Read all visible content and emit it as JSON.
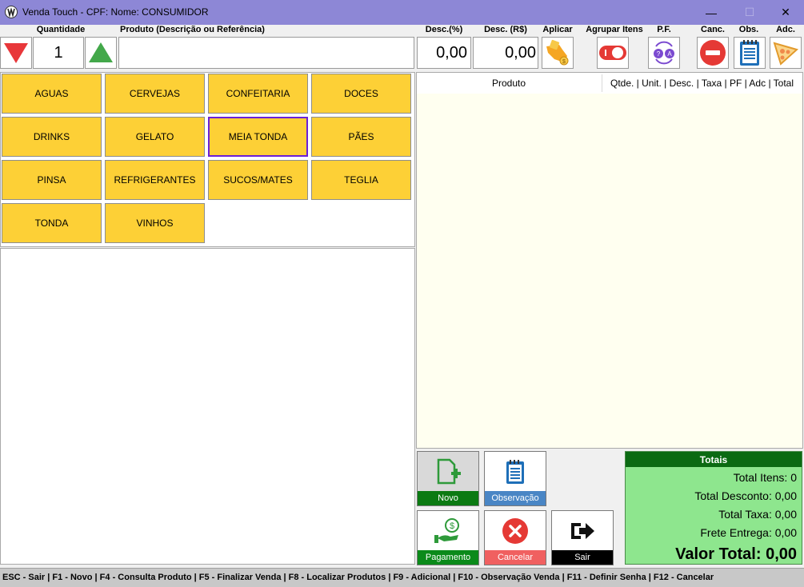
{
  "window": {
    "title": "Venda Touch   -   CPF:  Nome: CONSUMIDOR",
    "minimize": "—",
    "maximize": "☐",
    "close": "✕"
  },
  "header": {
    "quantidade_label": "Quantidade",
    "produto_label": "Produto (Descrição ou Referência)",
    "desc_pct_label": "Desc.(%)",
    "desc_rs_label": "Desc. (R$)",
    "aplicar_label": "Aplicar",
    "agrupar_label": "Agrupar Itens",
    "pf_label": "P.F.",
    "canc_label": "Canc.",
    "obs_label": "Obs.",
    "adc_label": "Adc."
  },
  "controls": {
    "quantity": "1",
    "product_search": "",
    "desc_pct": "0,00",
    "desc_rs": "0,00"
  },
  "categories": [
    "AGUAS",
    "CERVEJAS",
    "CONFEITARIA",
    "DOCES",
    "DRINKS",
    "GELATO",
    "MEIA TONDA",
    "PÃES",
    "PINSA",
    "REFRIGERANTES",
    "SUCOS/MATES",
    "TEGLIA",
    "TONDA",
    "VINHOS"
  ],
  "selected_category": "MEIA TONDA",
  "grid": {
    "col_produto": "Produto",
    "col_rest": "Qtde. | Unit. | Desc. | Taxa | PF | Adc | Total"
  },
  "actions": {
    "novo": "Novo",
    "observacao": "Observação",
    "pagamento": "Pagamento",
    "cancelar": "Cancelar",
    "sair": "Sair"
  },
  "totals": {
    "title": "Totais",
    "total_itens": "Total Itens: 0",
    "total_desconto": "Total Desconto: 0,00",
    "total_taxa": "Total Taxa: 0,00",
    "frete_entrega": "Frete Entrega: 0,00",
    "valor_total": "Valor Total: 0,00"
  },
  "statusbar": "ESC - Sair | F1 - Novo | F4 - Consulta Produto | F5 - Finalizar Venda | F8 - Localizar Produtos | F9 - Adicional | F10 - Observação Venda | F11 - Definir Senha | F12 - Cancelar",
  "colors": {
    "titlebar": "#8d87d6",
    "category": "#fdd036",
    "selected_border": "#6a1fd6",
    "totals_bg": "#8ee68e",
    "totals_head": "#0b6a12",
    "novo": "#0b7a12",
    "observacao": "#4a86c5",
    "pagamento": "#0b8a1a",
    "cancelar": "#f06060",
    "sair": "#000000"
  },
  "icons": {
    "logo": "app-logo-icon",
    "decrease": "triangle-down-icon",
    "increase": "triangle-up-icon",
    "aplicar": "hand-coin-icon",
    "agrupar": "toggle-icon",
    "pf": "question-cycle-icon",
    "canc": "minus-circle-icon",
    "obs": "notepad-icon",
    "adc": "pizza-icon"
  }
}
